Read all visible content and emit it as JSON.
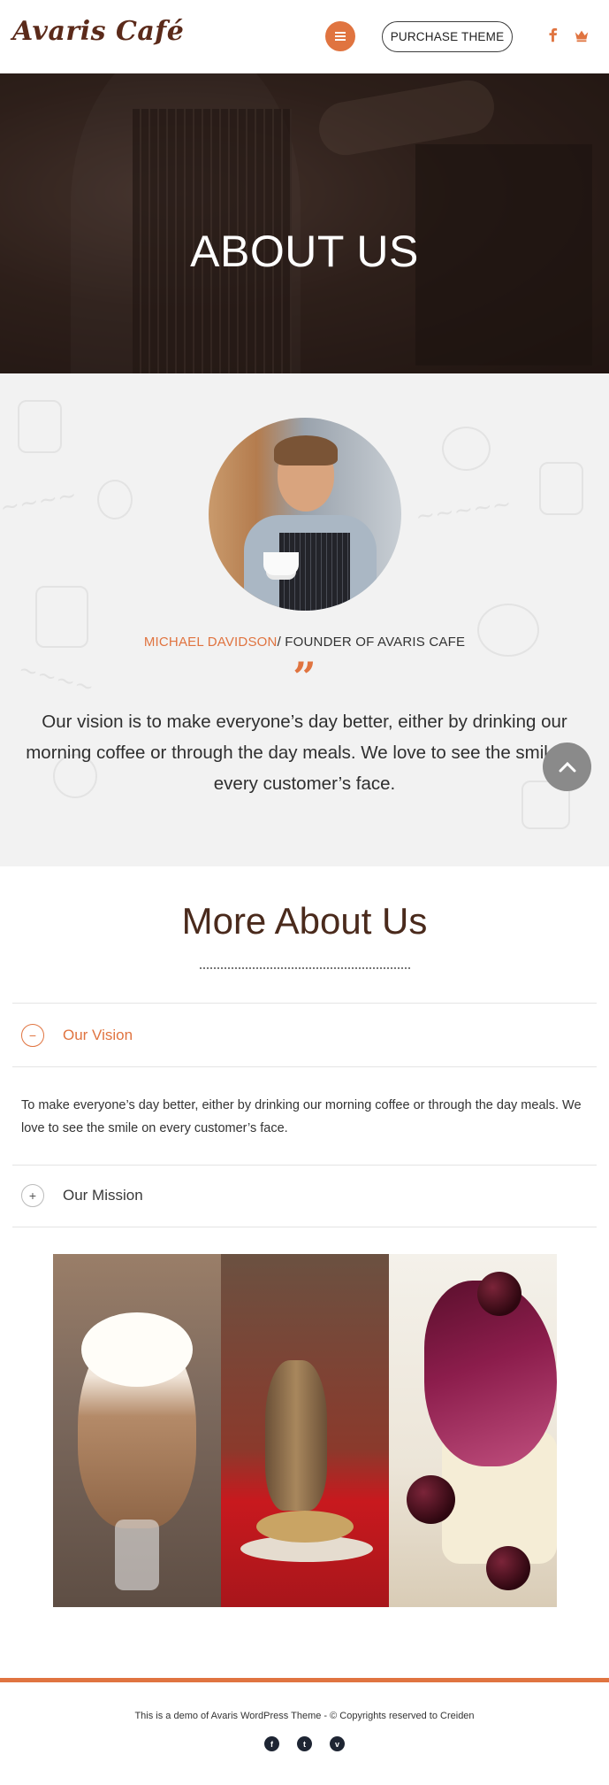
{
  "header": {
    "logo_text": "Avaris Café",
    "purchase_label": "PURCHASE THEME",
    "menu_icon": "hamburger-icon",
    "social_icons": [
      "facebook-icon",
      "crown-icon"
    ]
  },
  "hero": {
    "title": "ABOUT US"
  },
  "founder": {
    "name": "MICHAEL DAVIDSON",
    "role": "/ FOUNDER OF AVARIS CAFE",
    "quote_mark": "”",
    "quote": "Our vision is to make everyone’s day better, either by drinking our morning coffee or through the day meals. We love to see the smile on every customer’s face."
  },
  "more_about": {
    "title": "More About Us",
    "accordion": [
      {
        "title": "Our Vision",
        "toggle": "−",
        "expanded": true,
        "body": "To make everyone’s day better, either by drinking our morning coffee or through the day meals. We love to see the smile on every customer’s face."
      },
      {
        "title": "Our Mission",
        "toggle": "+",
        "expanded": false
      }
    ]
  },
  "gallery": {
    "images": [
      "coffee-glass-image",
      "lantern-table-image",
      "cherry-cheesecake-image"
    ]
  },
  "footer": {
    "text": "This is a demo of Avaris WordPress Theme - © Copyrights reserved to Creiden",
    "social": [
      {
        "icon": "facebook-icon",
        "glyph": "f"
      },
      {
        "icon": "twitter-icon",
        "glyph": "t"
      },
      {
        "icon": "vimeo-icon",
        "glyph": "v"
      }
    ]
  },
  "colors": {
    "accent": "#e07440",
    "heading_brown": "#4a2a1c",
    "footer_icon_bg": "#1e2533"
  }
}
